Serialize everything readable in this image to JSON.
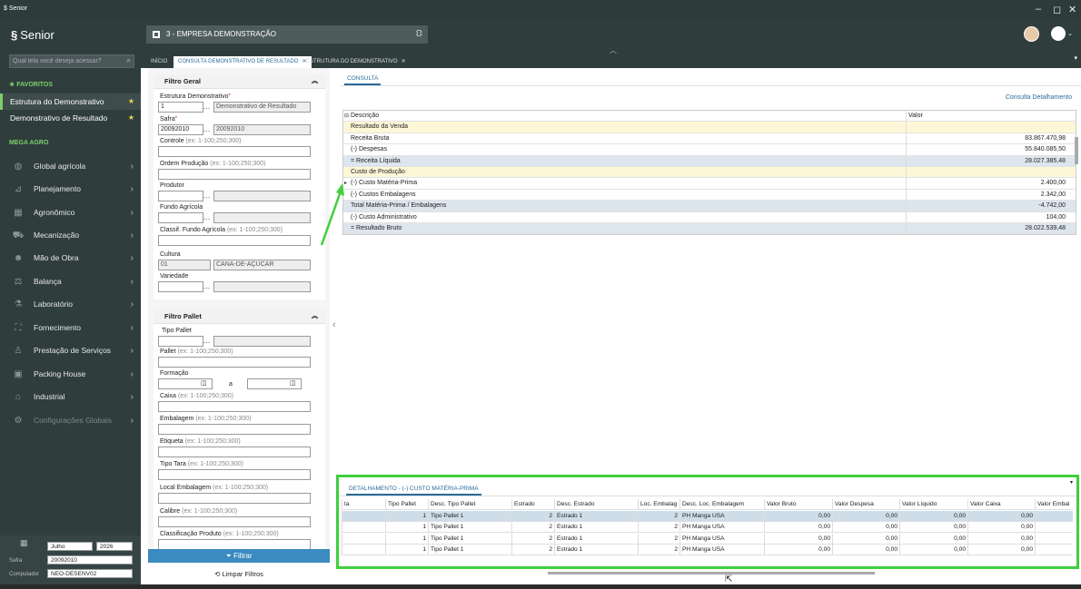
{
  "titlebar": {
    "app": "$ Senior",
    "minimize": "–",
    "restore": "◻",
    "close": "✕"
  },
  "sidebar": {
    "logo": "Senior",
    "search_placeholder": "Qual tela você deseja acessar?",
    "favorites_title": "★ FAVORITOS",
    "favorites": [
      {
        "label": "Estrutura do Demonstrativo"
      },
      {
        "label": "Demonstrativo de Resultado"
      }
    ],
    "section_title": "MEGA AGRO",
    "menu": [
      {
        "label": "Global agrícola",
        "icon": "globe-icon"
      },
      {
        "label": "Planejamento",
        "icon": "chart-icon"
      },
      {
        "label": "Agronômico",
        "icon": "field-icon"
      },
      {
        "label": "Mecanização",
        "icon": "tractor-icon"
      },
      {
        "label": "Mão de Obra",
        "icon": "people-icon"
      },
      {
        "label": "Balança",
        "icon": "scale-icon"
      },
      {
        "label": "Laboratório",
        "icon": "flask-icon"
      },
      {
        "label": "Fornecimento",
        "icon": "supply-icon"
      },
      {
        "label": "Prestação de Serviços",
        "icon": "service-icon"
      },
      {
        "label": "Packing House",
        "icon": "box-icon"
      },
      {
        "label": "Industrial",
        "icon": "factory-icon"
      },
      {
        "label": "Configurações Globais",
        "icon": "gear-icon"
      }
    ],
    "bottom": {
      "month": "Julho",
      "year": "2026",
      "safra_label": "Safra",
      "safra": "20092010",
      "computer_label": "Computador",
      "computer": "NEO-DESENV02"
    }
  },
  "header": {
    "company": "3 - EMPRESA DEMONSTRAÇÃO"
  },
  "tabs": [
    {
      "label": "INÍCIO"
    },
    {
      "label": "CONSULTA DEMONSTRATIVO DE RESULTADO"
    },
    {
      "label": "ESTRUTURA DO DEMONSTRATIVO"
    }
  ],
  "filtro_geral": {
    "title": "Filtro Geral",
    "estrutura_label": "Estrutura Demonstrativo",
    "estrutura_code": "1",
    "estrutura_desc": "Demonstrativo de Resultado",
    "safra_label": "Safra",
    "safra_code": "20092010",
    "safra_desc": "20092010",
    "controle_label": "Controle",
    "range_hint": "(ex: 1-100;250;300)",
    "ordem_label": "Ordem Produção",
    "produtor_label": "Produtor",
    "fundo_label": "Fundo Agrícola",
    "classif_label": "Classif. Fundo Agrícola",
    "cultura_label": "Cultura",
    "cultura_code": "01",
    "cultura_desc": "CANA-DE-AÇUCAR",
    "variedade_label": "Variedade"
  },
  "filtro_pallet": {
    "title": "Filtro Pallet",
    "tipo_pallet_label": "Tipo Pallet",
    "pallet_label": "Pallet",
    "formacao_label": "Formação",
    "formacao_sep": "a",
    "caixa_label": "Caixa",
    "embalagem_label": "Embalagem",
    "etiqueta_label": "Etiqueta",
    "tipo_tara_label": "Tipo Tara",
    "local_embalagem_label": "Local Embalagem",
    "calibre_label": "Calibre",
    "classificacao_label": "Classificação Produto",
    "range_hint": "(ex: 1-100;250;300)"
  },
  "buttons": {
    "filtrar": "Filtrar",
    "limpar": "Limpar Filtros"
  },
  "consulta": {
    "tab": "CONSULTA",
    "detail_link": "Consulta Detalhamento",
    "columns": [
      "Descrição",
      "Valor"
    ],
    "rows": [
      {
        "desc": "Resultado da Venda",
        "valor": "",
        "style": "hy"
      },
      {
        "desc": "Receita Bruta",
        "valor": "83.867.470,98",
        "style": ""
      },
      {
        "desc": "(-) Despesas",
        "valor": "55.840.085,50",
        "style": ""
      },
      {
        "desc": "= Receita Líquida",
        "valor": "28.027.385,48",
        "style": "hb"
      },
      {
        "desc": "Custo de Produção",
        "valor": "",
        "style": "hy"
      },
      {
        "desc": "(-) Custo Matéria-Prima",
        "valor": "2.400,00",
        "style": "",
        "ind": "▸"
      },
      {
        "desc": "(-) Custos Embalagens",
        "valor": "2.342,00",
        "style": ""
      },
      {
        "desc": "Total Matéria-Prima / Embalagens",
        "valor": "-4.742,00",
        "style": "hb"
      },
      {
        "desc": "(-) Custo Administrativo",
        "valor": "104,00",
        "style": ""
      },
      {
        "desc": "= Resultado Bruto",
        "valor": "28.022.539,48",
        "style": "hb"
      }
    ]
  },
  "detalhamento": {
    "tab": "DETALHAMENTO - (-) CUSTO MATÉRIA-PRIMA",
    "columns": [
      "ta",
      "Tipo Pallet",
      "Desc. Tipo Pallet",
      "Estrado",
      "Desc. Estrado",
      "Loc. Embalag",
      "Desc. Loc. Embalagem",
      "Valor Bruto",
      "Valor Despesa",
      "Valor Líquido",
      "Valor Caixa",
      "Valor Embal"
    ],
    "rows": [
      [
        "",
        "1",
        "Tipo Pallet 1",
        "2",
        "Estrado 1",
        "2",
        "PH Manga USA",
        "0,00",
        "0,00",
        "0,00",
        "0,00",
        ""
      ],
      [
        "",
        "1",
        "Tipo Pallet 1",
        "2",
        "Estrado 1",
        "2",
        "PH Manga USA",
        "0,00",
        "0,00",
        "0,00",
        "0,00",
        ""
      ],
      [
        "",
        "1",
        "Tipo Pallet 1",
        "2",
        "Estrado 1",
        "2",
        "PH Manga USA",
        "0,00",
        "0,00",
        "0,00",
        "0,00",
        ""
      ],
      [
        "",
        "1",
        "Tipo Pallet 1",
        "2",
        "Estrado 1",
        "2",
        "PH Manga USA",
        "0,00",
        "0,00",
        "0,00",
        "0,00",
        ""
      ]
    ]
  },
  "colors": {
    "accent": "#3b8ac0",
    "sidebar": "#2f3d3d",
    "highlight": "#3fcf3f"
  }
}
